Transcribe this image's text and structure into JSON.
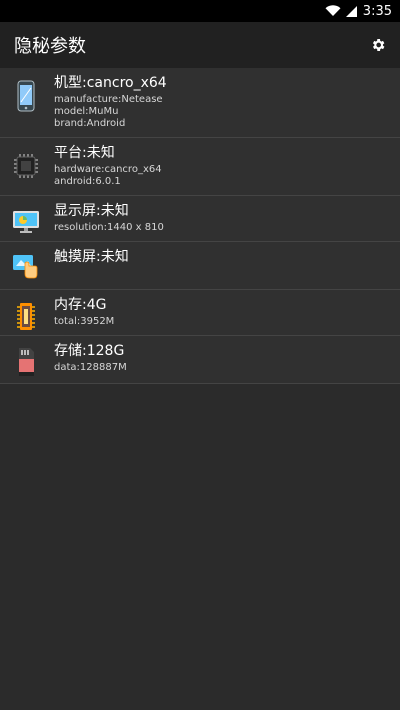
{
  "status_bar": {
    "time": "3:35"
  },
  "app_bar": {
    "title": "隐秘参数"
  },
  "items": [
    {
      "title": "机型:cancro_x64",
      "lines": [
        "manufacture:Netease",
        "model:MuMu",
        "brand:Android"
      ],
      "icon": "phone-icon"
    },
    {
      "title": "平台:未知",
      "lines": [
        "hardware:cancro_x64",
        "android:6.0.1"
      ],
      "icon": "chip-icon"
    },
    {
      "title": "显示屏:未知",
      "lines": [
        "resolution:1440 x 810"
      ],
      "icon": "monitor-icon"
    },
    {
      "title": "触摸屏:未知",
      "lines": [],
      "icon": "touch-icon"
    },
    {
      "title": "内存:4G",
      "lines": [
        "total:3952M"
      ],
      "icon": "memory-icon"
    },
    {
      "title": "存储:128G",
      "lines": [
        "data:128887M"
      ],
      "icon": "sdcard-icon"
    }
  ]
}
